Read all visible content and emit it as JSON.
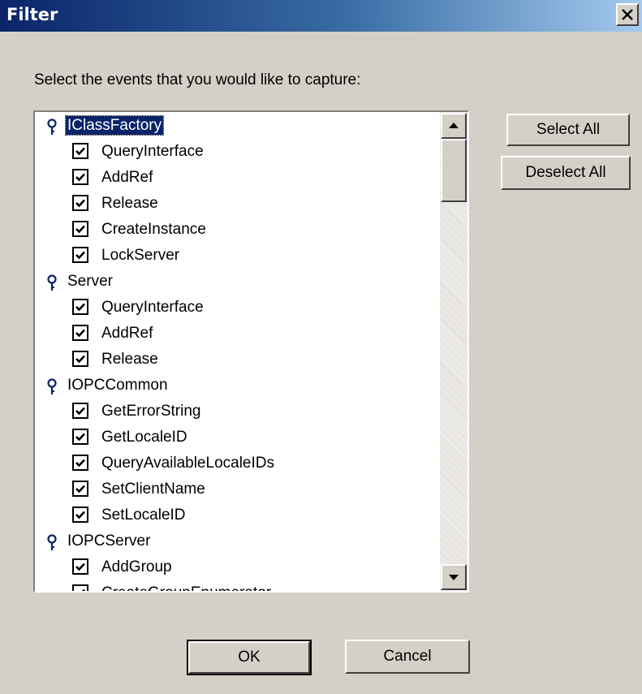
{
  "window": {
    "title": "Filter"
  },
  "prompt": "Select the events that you would like to capture:",
  "rows": [
    {
      "type": "group",
      "label": "IClassFactory",
      "selected": true
    },
    {
      "type": "item",
      "label": "QueryInterface",
      "checked": true
    },
    {
      "type": "item",
      "label": "AddRef",
      "checked": true
    },
    {
      "type": "item",
      "label": "Release",
      "checked": true
    },
    {
      "type": "item",
      "label": "CreateInstance",
      "checked": true
    },
    {
      "type": "item",
      "label": "LockServer",
      "checked": true
    },
    {
      "type": "group",
      "label": "Server",
      "selected": false
    },
    {
      "type": "item",
      "label": "QueryInterface",
      "checked": true
    },
    {
      "type": "item",
      "label": "AddRef",
      "checked": true
    },
    {
      "type": "item",
      "label": "Release",
      "checked": true
    },
    {
      "type": "group",
      "label": "IOPCCommon",
      "selected": false
    },
    {
      "type": "item",
      "label": "GetErrorString",
      "checked": true
    },
    {
      "type": "item",
      "label": "GetLocaleID",
      "checked": true
    },
    {
      "type": "item",
      "label": "QueryAvailableLocaleIDs",
      "checked": true
    },
    {
      "type": "item",
      "label": "SetClientName",
      "checked": true
    },
    {
      "type": "item",
      "label": "SetLocaleID",
      "checked": true
    },
    {
      "type": "group",
      "label": "IOPCServer",
      "selected": false
    },
    {
      "type": "item",
      "label": "AddGroup",
      "checked": true
    },
    {
      "type": "item",
      "label": "CreateGroupEnumerator",
      "checked": true
    }
  ],
  "buttons": {
    "select_all": "Select All",
    "deselect_all": "Deselect All",
    "ok": "OK",
    "cancel": "Cancel"
  },
  "icons": {
    "close": "close-icon",
    "group": "key-pin-icon",
    "check": "checkmark-icon"
  },
  "colors": {
    "title_start": "#0a246a",
    "title_end": "#a6caf0",
    "selection": "#0a246a",
    "face": "#d4d0c8"
  }
}
